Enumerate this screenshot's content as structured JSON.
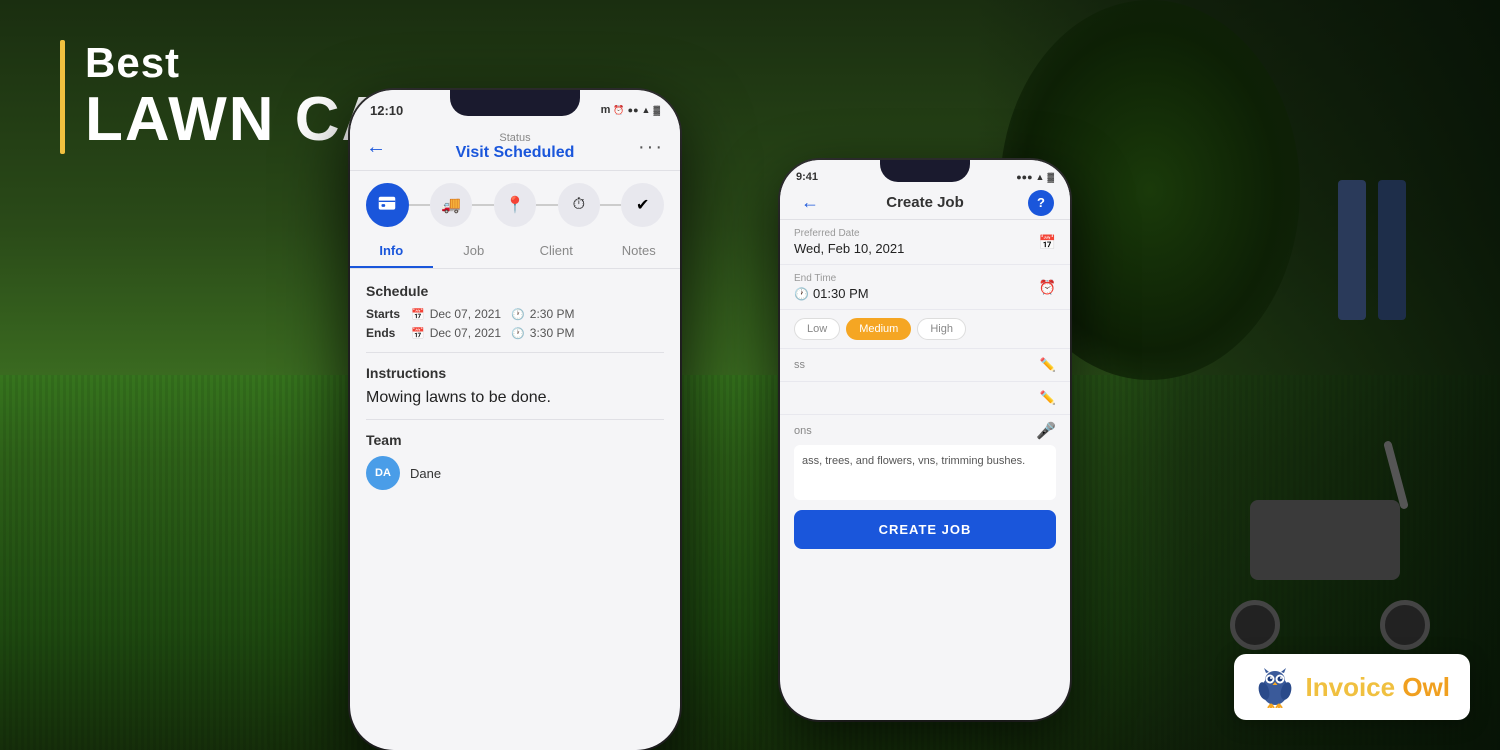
{
  "page": {
    "title": "Best Lawn Care Apps"
  },
  "heading": {
    "line1": "Best",
    "line2": "LAWN CARE APPS"
  },
  "front_phone": {
    "status_bar": {
      "time": "12:10",
      "carrier": "m",
      "battery_icons": "▓ ▓ ▓"
    },
    "header": {
      "back_label": "←",
      "status_label": "Status",
      "status_value": "Visit Scheduled",
      "menu_dots": "···"
    },
    "steps": [
      {
        "icon": "📋",
        "active": true
      },
      {
        "icon": "🚚",
        "active": false
      },
      {
        "icon": "📍",
        "active": false
      },
      {
        "icon": "⏱",
        "active": false
      },
      {
        "icon": "✓",
        "active": false
      }
    ],
    "tabs": [
      "Info",
      "Job",
      "Client",
      "Notes"
    ],
    "active_tab": "Info",
    "schedule": {
      "title": "Schedule",
      "starts_label": "Starts",
      "starts_date": "Dec 07, 2021",
      "starts_time": "2:30 PM",
      "ends_label": "Ends",
      "ends_date": "Dec 07, 2021",
      "ends_time": "3:30 PM"
    },
    "instructions": {
      "title": "Instructions",
      "text": "Mowing lawns to be done."
    },
    "team": {
      "title": "Team",
      "member_initials": "DA",
      "member_name": "Dane"
    }
  },
  "back_phone": {
    "status_bar": {
      "time": "9:41",
      "signal": "●●●",
      "wifi": "WiFi",
      "battery": "■"
    },
    "header": {
      "back_label": "←",
      "title": "Create Job",
      "help_label": "?"
    },
    "preferred_date": {
      "label": "Preferred Date",
      "value": "Wed, Feb 10, 2021"
    },
    "end_time": {
      "label": "End Time",
      "value": "01:30 PM"
    },
    "priority": {
      "options": [
        "Low",
        "Medium",
        "High"
      ],
      "active": "Medium"
    },
    "edit_rows": [
      {
        "text": "ss"
      },
      {
        "text": ""
      }
    ],
    "voice_label": "ons",
    "notes_text": "ass, trees, and flowers,\nvns, trimming bushes.",
    "create_btn": "CREATE JOB"
  },
  "invoice_owl": {
    "brand_name_part1": "Invoice ",
    "brand_name_part2": "Owl"
  }
}
